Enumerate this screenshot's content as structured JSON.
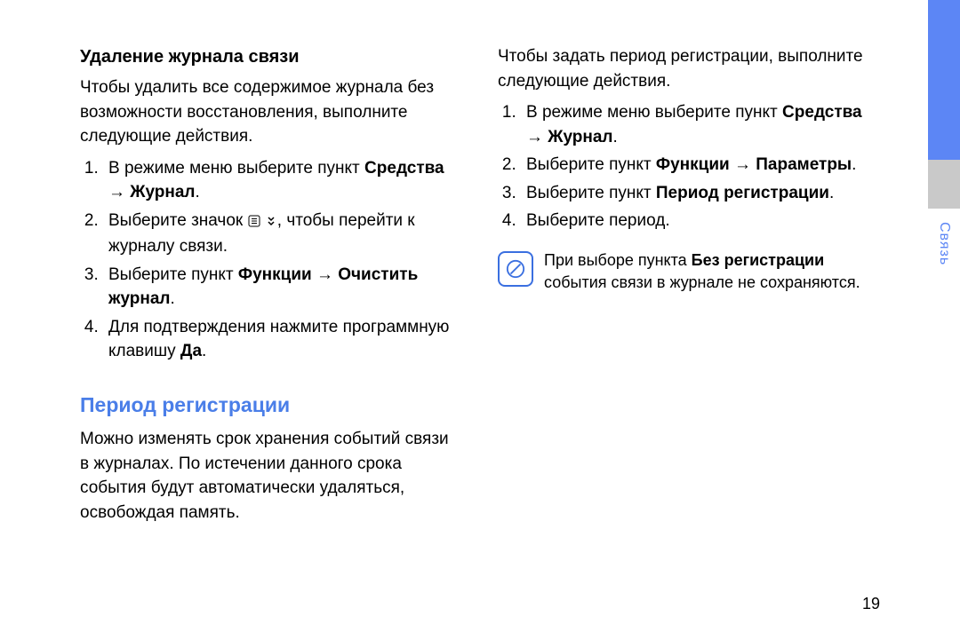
{
  "left": {
    "h1": "Удаление журнала связи",
    "intro": "Чтобы удалить все содержимое журнала без возможности восстановления, выполните следующие действия.",
    "step1_a": "В режиме меню выберите пункт ",
    "step1_b1": "Средства",
    "step1_arrow": " → ",
    "step1_b2": "Журнал",
    "step1_c": ".",
    "step2_a": "Выберите значок ",
    "step2_b": ", чтобы перейти к журналу связи.",
    "step3_a": "Выберите пункт ",
    "step3_b1": "Функции",
    "step3_arrow": " → ",
    "step3_b2": "Очистить журнал",
    "step3_c": ".",
    "step4_a": "Для подтверждения нажмите программную клавишу ",
    "step4_b": "Да",
    "step4_c": ".",
    "h2": "Период регистрации",
    "p2": "Можно изменять срок хранения событий связи в журналах. По истечении данного срока события будут автоматически удаляться, освобождая память."
  },
  "right": {
    "intro": "Чтобы задать период регистрации, выполните следующие действия.",
    "step1_a": "В режиме меню выберите пункт ",
    "step1_b1": "Средства",
    "step1_arrow": " → ",
    "step1_b2": "Журнал",
    "step1_c": ".",
    "step2_a": "Выберите пункт ",
    "step2_b1": "Функции",
    "step2_arrow": " → ",
    "step2_b2": "Параметры",
    "step2_c": ".",
    "step3_a": "Выберите пункт ",
    "step3_b": "Период регистрации",
    "step3_c": ".",
    "step4": "Выберите период.",
    "note_a": "При выборе пункта ",
    "note_b": "Без регистрации",
    "note_c": " события связи в журнале не сохраняются."
  },
  "tab_label": "Связь",
  "page_number": "19"
}
